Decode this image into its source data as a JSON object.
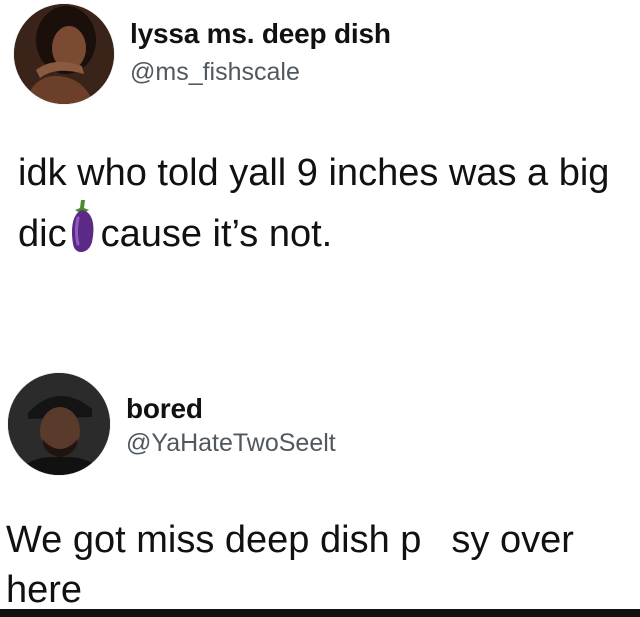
{
  "tweet1": {
    "name": "lyssa ms. deep dish",
    "handle": "@ms_fishscale",
    "line1": "idk who told yall 9 inches was a big",
    "line2_before": "dic",
    "line2_emoji": "eggplant-emoji",
    "line2_after": "cause it’s not."
  },
  "tweet2": {
    "name": "bored",
    "handle": "@YaHateTwoSeelt",
    "line1_before": "We got miss deep dish p",
    "line1_after": "sy over",
    "line2": "here"
  },
  "colors": {
    "background": "#ffffff",
    "text": "#111111",
    "handle": "#505860",
    "eggplant": "#5b2a86"
  }
}
